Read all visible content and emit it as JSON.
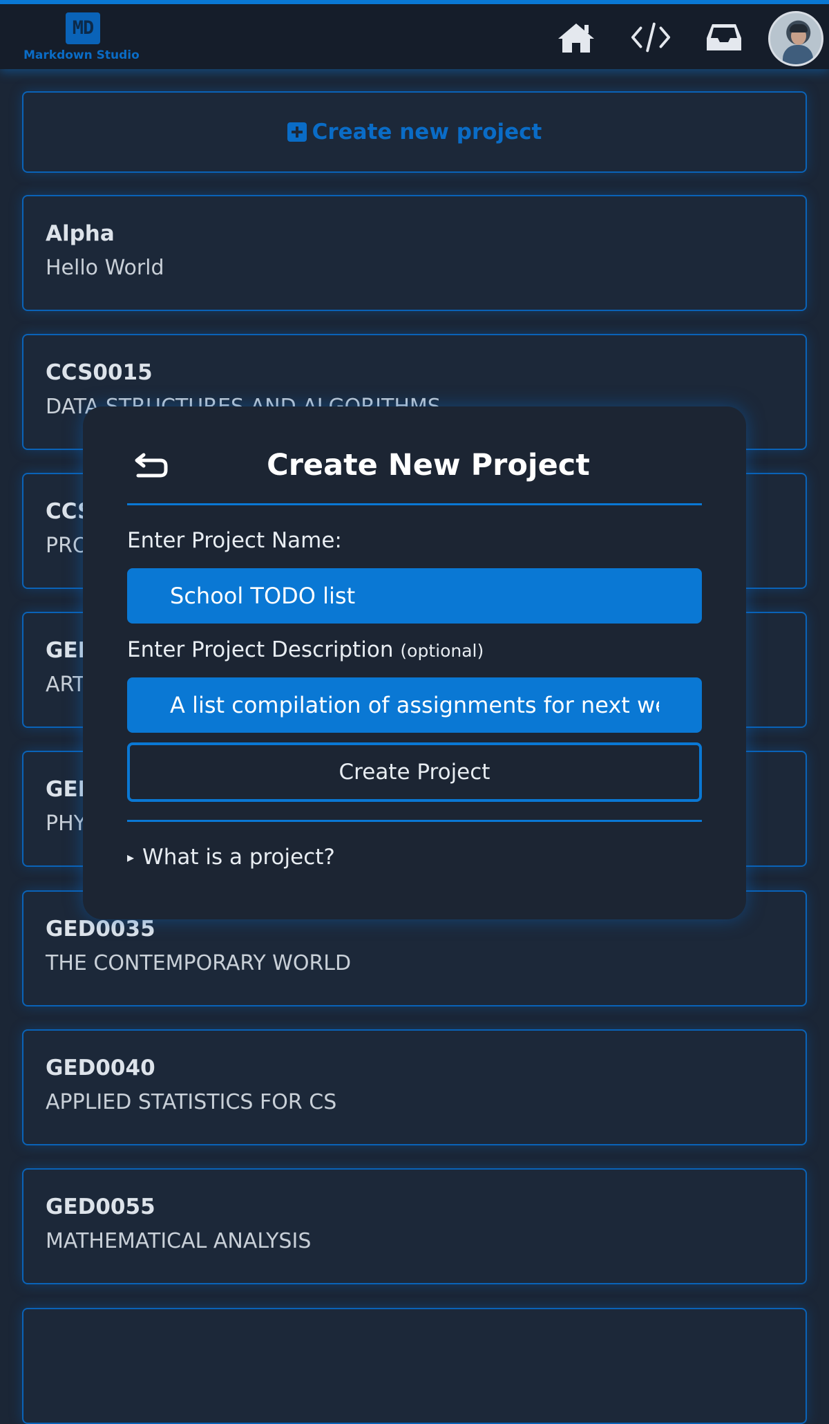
{
  "app": {
    "logo_mark": "MD",
    "logo_text": "Markdown  Studio"
  },
  "nav": {
    "icons": [
      "home-icon",
      "code-icon",
      "inbox-icon"
    ],
    "avatar": "user-avatar"
  },
  "create_card": {
    "label": "Create new project",
    "icon": "plus-square-icon"
  },
  "projects": [
    {
      "code": "Alpha",
      "description": "Hello World"
    },
    {
      "code": "CCS0015",
      "description": "DATA STRUCTURES AND ALGORITHMS"
    },
    {
      "code": "CCS",
      "description": "PRO"
    },
    {
      "code": "GED",
      "description": "ART"
    },
    {
      "code": "GED",
      "description": "PHY"
    },
    {
      "code": "GED0035",
      "description": "THE CONTEMPORARY WORLD"
    },
    {
      "code": "GED0040",
      "description": "APPLIED STATISTICS FOR CS"
    },
    {
      "code": "GED0055",
      "description": "MATHEMATICAL ANALYSIS"
    }
  ],
  "modal": {
    "title": "Create New Project",
    "back_icon": "return-arrow-icon",
    "name_label": "Enter Project Name:",
    "name_value": "School TODO list",
    "description_label": "Enter Project Description",
    "description_optional": "(optional)",
    "description_value": "A list compilation of assignments for next we",
    "submit_label": "Create Project",
    "details_label": "What is a project?",
    "details_marker": "▸"
  },
  "colors": {
    "accent": "#0a78d4",
    "background": "#1b2636",
    "navbar": "#151d2a",
    "modal": "#1c2533"
  }
}
